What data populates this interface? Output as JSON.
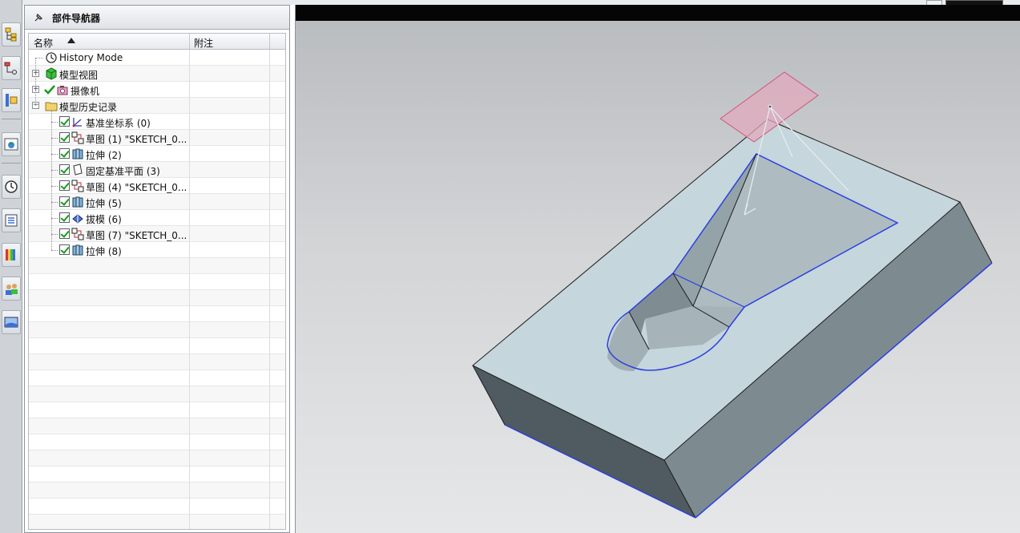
{
  "navigator": {
    "title": "部件导航器",
    "columns": {
      "name": "名称",
      "note": "附注"
    },
    "rows": [
      {
        "label": "History Mode",
        "icon": "clock-icon"
      },
      {
        "label": "模型视图",
        "icon": "model-views-icon",
        "expander": "+"
      },
      {
        "label": "摄像机",
        "icon": "camera-icon",
        "expander": "+"
      },
      {
        "label": "模型历史记录",
        "icon": "folder-icon",
        "expander": "-"
      },
      {
        "label": "基准坐标系 (0)",
        "icon": "datum-csys-icon"
      },
      {
        "label": "草图 (1) \"SKETCH_0...",
        "icon": "sketch-icon"
      },
      {
        "label": "拉伸 (2)",
        "icon": "extrude-icon"
      },
      {
        "label": "固定基准平面 (3)",
        "icon": "datum-plane-icon"
      },
      {
        "label": "草图 (4) \"SKETCH_0...",
        "icon": "sketch-icon"
      },
      {
        "label": "拉伸 (5)",
        "icon": "extrude-icon"
      },
      {
        "label": "拔模 (6)",
        "icon": "draft-icon"
      },
      {
        "label": "草图 (7) \"SKETCH_0...",
        "icon": "sketch-icon"
      },
      {
        "label": "拉伸 (8)",
        "icon": "extrude-icon"
      }
    ]
  },
  "resource_bar": {
    "buttons": [
      "assembly-navigator-icon",
      "constraint-navigator-icon",
      "part-navigator-icon",
      "web-browser-icon",
      "history-icon",
      "reuse-library-icon",
      "color-palette-icon",
      "roles-icon",
      "system-scenes-icon"
    ]
  },
  "colors": {
    "solid_top": "#c5d6dc",
    "solid_side_dark": "#4f5a61",
    "solid_side_light": "#7d8b90",
    "edge_highlight": "#2c3fe0",
    "datum_plane": "#e0a9bc"
  }
}
